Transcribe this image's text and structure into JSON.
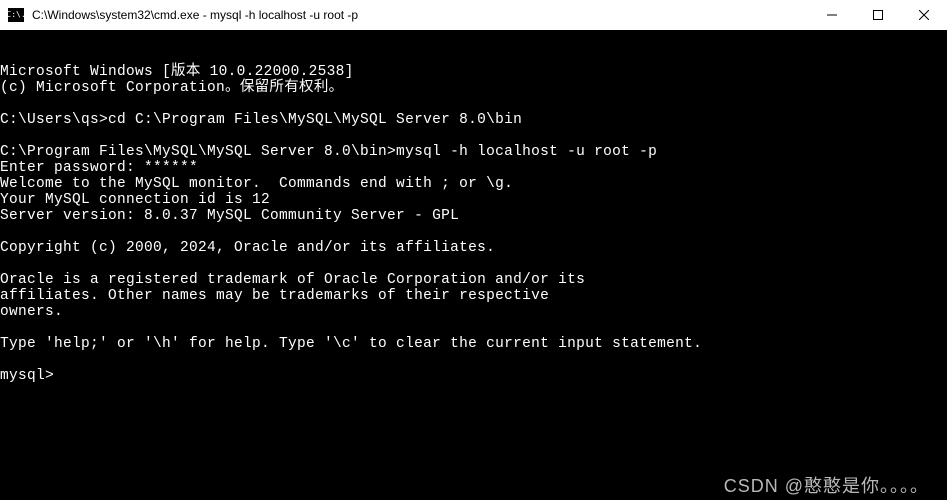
{
  "titlebar": {
    "icon_label": "C:\\.",
    "title": "C:\\Windows\\system32\\cmd.exe - mysql  -h localhost -u root -p"
  },
  "window_controls": {
    "minimize": "minimize",
    "maximize": "maximize",
    "close": "close"
  },
  "terminal_lines": [
    "Microsoft Windows [版本 10.0.22000.2538]",
    "(c) Microsoft Corporation。保留所有权利。",
    "",
    "C:\\Users\\qs>cd C:\\Program Files\\MySQL\\MySQL Server 8.0\\bin",
    "",
    "C:\\Program Files\\MySQL\\MySQL Server 8.0\\bin>mysql -h localhost -u root -p",
    "Enter password: ******",
    "Welcome to the MySQL monitor.  Commands end with ; or \\g.",
    "Your MySQL connection id is 12",
    "Server version: 8.0.37 MySQL Community Server - GPL",
    "",
    "Copyright (c) 2000, 2024, Oracle and/or its affiliates.",
    "",
    "Oracle is a registered trademark of Oracle Corporation and/or its",
    "affiliates. Other names may be trademarks of their respective",
    "owners.",
    "",
    "Type 'help;' or '\\h' for help. Type '\\c' to clear the current input statement.",
    "",
    "mysql>"
  ],
  "watermark": "CSDN @憨憨是你。。。。"
}
